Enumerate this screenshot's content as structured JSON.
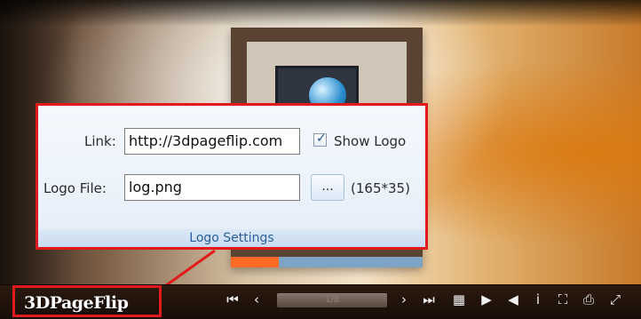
{
  "panel": {
    "link_label": "Link:",
    "link_value": "http://3dpageflip.com",
    "show_logo_label": "Show Logo",
    "show_logo_checked": true,
    "logo_file_label": "Logo File:",
    "logo_file_value": "log.png",
    "browse_label": "...",
    "logo_size": "(165*35)",
    "footer_title": "Logo Settings"
  },
  "toolbar": {
    "brand": "3DPageFlip",
    "first_icon": "first-page-icon",
    "prev_icon": "previous-page-icon",
    "page_indicator": "1/8",
    "next_icon": "next-page-icon",
    "last_icon": "last-page-icon",
    "thumbnails_icon": "thumbnails-icon",
    "autoplay_icon": "play-icon",
    "sound_icon": "sound-icon",
    "info_icon": "info-icon",
    "share_icon": "share-icon",
    "print_icon": "print-icon",
    "fullscreen_icon": "fullscreen-icon"
  },
  "colors": {
    "highlight": "#e11b1b",
    "footer_text": "#2c5f9a",
    "toolbar_bg": "#1d110a"
  }
}
